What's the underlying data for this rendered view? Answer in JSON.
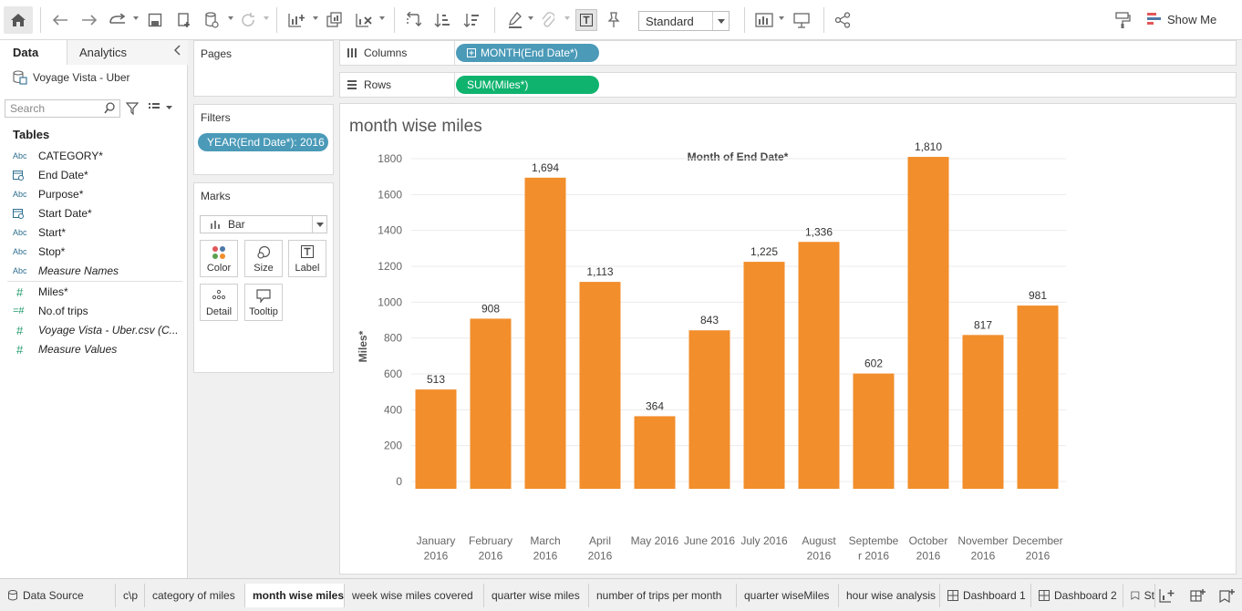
{
  "toolbar": {
    "mode_select": "Standard",
    "show_me": "Show Me"
  },
  "data_pane": {
    "tab_data": "Data",
    "tab_analytics": "Analytics",
    "datasource_name": "Voyage Vista - Uber",
    "search_placeholder": "Search",
    "tables_heading": "Tables",
    "dimensions": [
      {
        "type": "Abc",
        "name": "CATEGORY*"
      },
      {
        "type": "date",
        "name": "End Date*"
      },
      {
        "type": "Abc",
        "name": "Purpose*"
      },
      {
        "type": "date",
        "name": "Start Date*"
      },
      {
        "type": "Abc",
        "name": "Start*"
      },
      {
        "type": "Abc",
        "name": "Stop*"
      },
      {
        "type": "Abc",
        "name": "Measure Names"
      }
    ],
    "measures": [
      {
        "type": "#",
        "name": "Miles*"
      },
      {
        "type": "=#",
        "name": "No.of trips"
      },
      {
        "type": "#",
        "name": "Voyage Vista - Uber.csv (C..."
      },
      {
        "type": "#",
        "name": "Measure Values"
      }
    ]
  },
  "pages_card": {
    "title": "Pages"
  },
  "filters_card": {
    "title": "Filters",
    "pill": "YEAR(End Date*): 2016"
  },
  "marks_card": {
    "title": "Marks",
    "mark_type": "Bar",
    "buttons": {
      "color": "Color",
      "size": "Size",
      "label": "Label",
      "detail": "Detail",
      "tooltip": "Tooltip"
    }
  },
  "shelves": {
    "columns_label": "Columns",
    "columns_pill": "MONTH(End Date*)",
    "rows_label": "Rows",
    "rows_pill": "SUM(Miles*)"
  },
  "sheet": {
    "title": "month wise miles"
  },
  "colors": {
    "bar": "#f28e2b",
    "pill_dimension": "#4a9ab8",
    "pill_measure": "#0fb36e"
  },
  "chart_data": {
    "type": "bar",
    "title": "Month of End Date*",
    "ylabel": "Miles*",
    "xlabel": "",
    "ylim": [
      0,
      1800
    ],
    "yticks": [
      0,
      200,
      400,
      600,
      800,
      1000,
      1200,
      1400,
      1600,
      1800
    ],
    "categories": [
      [
        "January",
        "2016"
      ],
      [
        "February",
        "2016"
      ],
      [
        "March",
        "2016"
      ],
      [
        "April",
        "2016"
      ],
      [
        "May 2016"
      ],
      [
        "June 2016"
      ],
      [
        "July 2016"
      ],
      [
        "August",
        "2016"
      ],
      [
        "Septembe",
        "r 2016"
      ],
      [
        "October",
        "2016"
      ],
      [
        "November",
        "2016"
      ],
      [
        "December",
        "2016"
      ]
    ],
    "values": [
      513,
      908,
      1694,
      1113,
      364,
      843,
      1225,
      1336,
      602,
      1810,
      817,
      981
    ],
    "data_labels": [
      "513",
      "908",
      "1,694",
      "1,113",
      "364",
      "843",
      "1,225",
      "1,336",
      "602",
      "1,810",
      "817",
      "981"
    ]
  },
  "sheet_tabs": [
    {
      "label": "Data Source",
      "icon": "database-icon"
    },
    {
      "label": "c\\p"
    },
    {
      "label": "category of miles"
    },
    {
      "label": "month wise miles",
      "active": true
    },
    {
      "label": "week wise miles covered"
    },
    {
      "label": "quarter wise miles"
    },
    {
      "label": "number of trips per month"
    },
    {
      "label": "quarter wiseMiles"
    },
    {
      "label": "hour wise analysis"
    },
    {
      "label": "Dashboard 1",
      "icon": "dashboard-icon"
    },
    {
      "label": "Dashboard 2",
      "icon": "dashboard-icon"
    },
    {
      "label": "St",
      "icon": "story-icon"
    }
  ]
}
